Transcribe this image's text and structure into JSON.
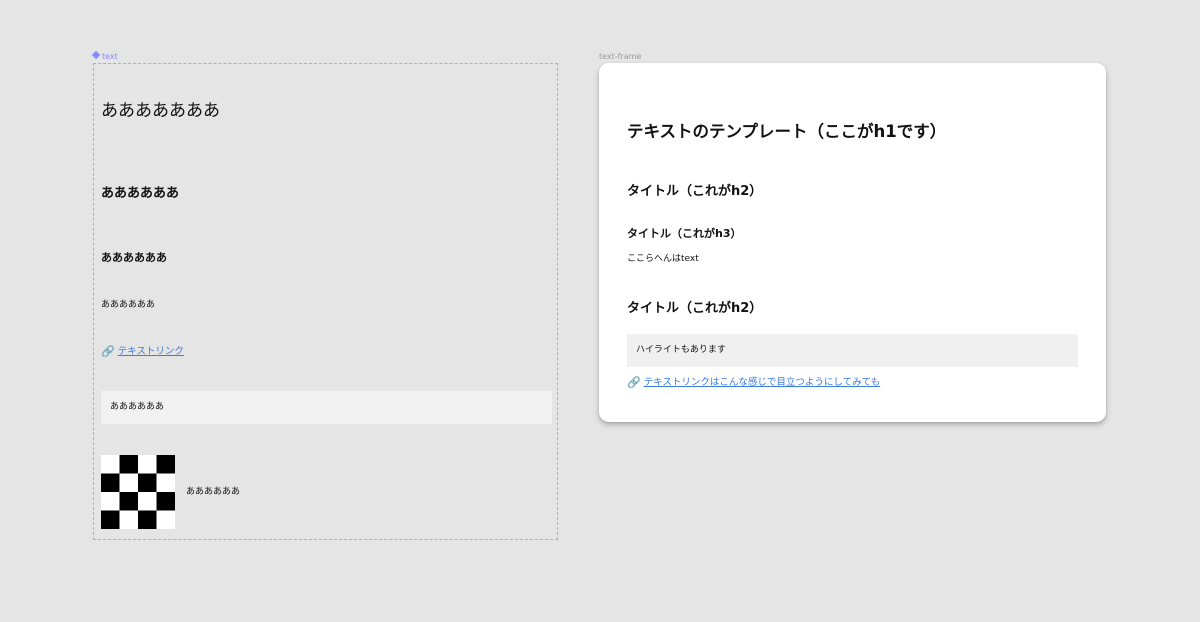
{
  "canvas": {
    "component_label": "text",
    "frame_label": "text-frame"
  },
  "component": {
    "h1": "あああああああ",
    "h2": "ああああああ",
    "h3": "ああああああ",
    "text": "ああああああ",
    "link_icon": "link-icon",
    "link": "テキストリンク",
    "highlight": "ああああああ",
    "image_caption": "ああああああ"
  },
  "frame": {
    "h1": "テキストのテンプレート（ここがh1です）",
    "h2_first": "タイトル（これがh2）",
    "h3": "タイトル（これがh3）",
    "text": "ここらへんはtext",
    "h2_second": "タイトル（これがh2）",
    "highlight": "ハイライトもあります",
    "link_icon": "link-icon",
    "link": "テキストリンクはこんな感じで目立つようにしてみても"
  },
  "colors": {
    "canvas_bg": "#e5e5e5",
    "component_outline": "#a9a4ff",
    "link": "#3a7be0",
    "highlight_bg": "#f0f0f0"
  }
}
